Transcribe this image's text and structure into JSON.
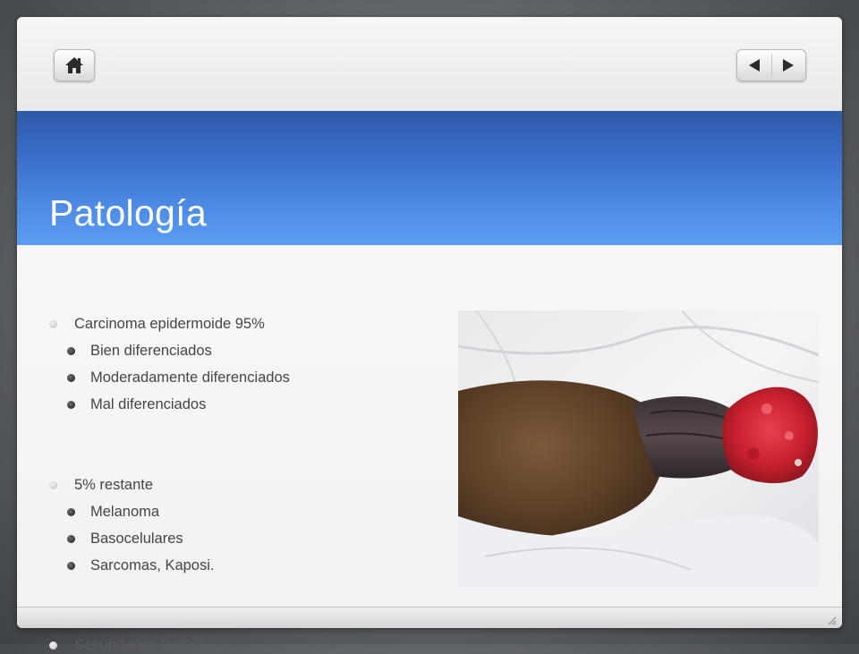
{
  "slide": {
    "title": "Patología",
    "bullets": [
      {
        "text": "Carcinoma epidermoide 95%",
        "sub": [
          "Bien diferenciados",
          "Moderadamente diferenciados",
          "Mal diferenciados"
        ]
      },
      {
        "text": "5% restante",
        "sub": [
          "Melanoma",
          "Basocelulares",
          "Sarcomas, Kaposi."
        ]
      },
      {
        "text": "Secundarios (raros)",
        "sub": []
      }
    ]
  },
  "icons": {
    "home": "home-icon",
    "previous": "triangle-left-icon",
    "next": "triangle-right-icon",
    "resize": "resize-grip-icon"
  },
  "colors": {
    "title_band": "#3a6fcb",
    "title_text": "#ffffff",
    "body_text": "#454545",
    "background": "#5e6165"
  }
}
